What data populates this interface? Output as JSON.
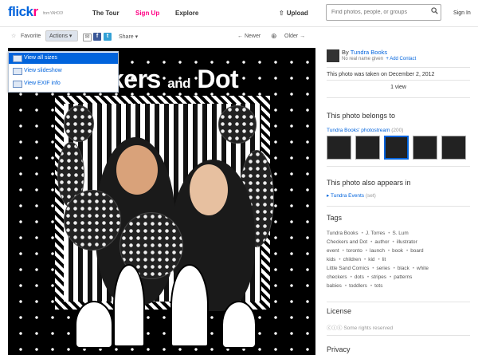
{
  "header": {
    "logo_a": "flick",
    "logo_b": "r",
    "logo_from": "from YAHOO!",
    "nav": [
      "The Tour",
      "Sign Up",
      "Explore"
    ],
    "upload": "Upload",
    "search_placeholder": "Find photos, people, or groups",
    "signin": "Sign In"
  },
  "toolbar": {
    "favorite": "Favorite",
    "actions": "Actions",
    "share": "Share",
    "newer": "Newer",
    "older": "Older"
  },
  "actions_menu": [
    "View all sizes",
    "View slideshow",
    "View EXIF info"
  ],
  "photo": {
    "title_a": "kers",
    "title_and": "and",
    "title_b": "Dot"
  },
  "sidebar": {
    "by_prefix": "By",
    "owner": "Tundra Books",
    "owner_sub": "No real name given",
    "add_contact": "+ Add Contact",
    "taken": "This photo was taken on December 2, 2012",
    "views": "1 view",
    "belongs_heading": "This photo belongs to",
    "photostream": "Tundra Books' photostream",
    "photostream_count": "(200)",
    "appears_heading": "This photo also appears in",
    "set_name": "Tundra Events",
    "set_type": "(set)",
    "tags_heading": "Tags",
    "tags": [
      [
        "Tundra Books",
        "J. Torres",
        "S. Lum"
      ],
      [
        "Checkers and Dot",
        "author",
        "illustrator"
      ],
      [
        "event",
        "toronto",
        "launch",
        "book",
        "board"
      ],
      [
        "kids",
        "children",
        "kid",
        "lit"
      ],
      [
        "Little Sand Comics",
        "series",
        "black",
        "white"
      ],
      [
        "checkers",
        "dots",
        "stripes",
        "patterns"
      ],
      [
        "babies",
        "toddlers",
        "tots"
      ]
    ],
    "license_heading": "License",
    "license_text": "Some rights reserved",
    "privacy_heading": "Privacy"
  }
}
